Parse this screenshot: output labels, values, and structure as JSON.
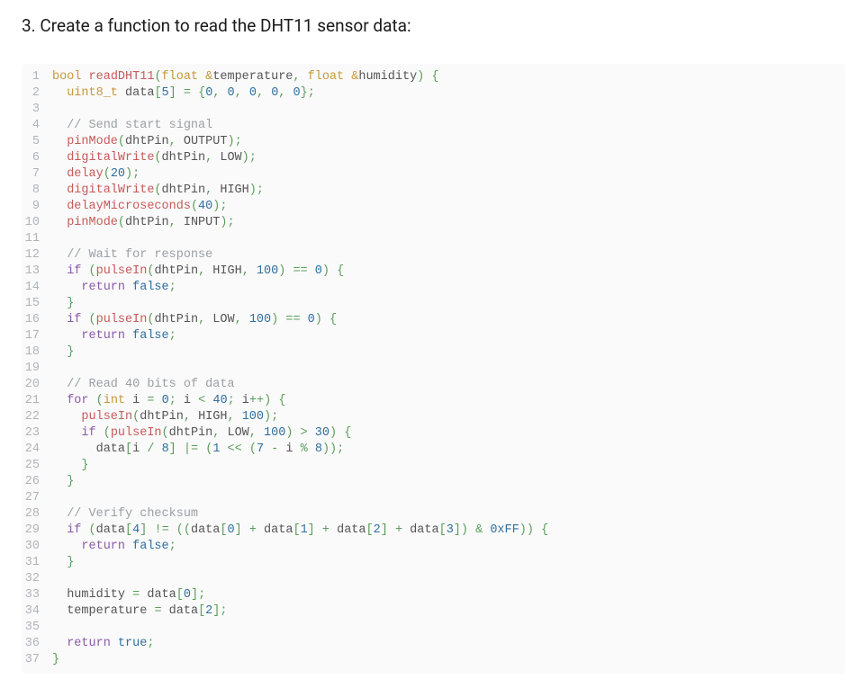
{
  "heading": "3. Create a function to read the DHT11 sensor data:",
  "code": {
    "lines": [
      [
        [
          "type",
          "bool"
        ],
        [
          "plain",
          " "
        ],
        [
          "func",
          "readDHT11"
        ],
        [
          "op",
          "("
        ],
        [
          "type",
          "float"
        ],
        [
          "plain",
          " "
        ],
        [
          "amp",
          "&"
        ],
        [
          "ident",
          "temperature"
        ],
        [
          "op",
          ","
        ],
        [
          "plain",
          " "
        ],
        [
          "type",
          "float"
        ],
        [
          "plain",
          " "
        ],
        [
          "amp",
          "&"
        ],
        [
          "ident",
          "humidity"
        ],
        [
          "op",
          ")"
        ],
        [
          "plain",
          " "
        ],
        [
          "op",
          "{"
        ]
      ],
      [
        [
          "plain",
          "  "
        ],
        [
          "type",
          "uint8_t"
        ],
        [
          "plain",
          " "
        ],
        [
          "ident",
          "data"
        ],
        [
          "op",
          "["
        ],
        [
          "num",
          "5"
        ],
        [
          "op",
          "]"
        ],
        [
          "plain",
          " "
        ],
        [
          "op",
          "="
        ],
        [
          "plain",
          " "
        ],
        [
          "op",
          "{"
        ],
        [
          "num",
          "0"
        ],
        [
          "op",
          ","
        ],
        [
          "plain",
          " "
        ],
        [
          "num",
          "0"
        ],
        [
          "op",
          ","
        ],
        [
          "plain",
          " "
        ],
        [
          "num",
          "0"
        ],
        [
          "op",
          ","
        ],
        [
          "plain",
          " "
        ],
        [
          "num",
          "0"
        ],
        [
          "op",
          ","
        ],
        [
          "plain",
          " "
        ],
        [
          "num",
          "0"
        ],
        [
          "op",
          "};"
        ]
      ],
      [],
      [
        [
          "plain",
          "  "
        ],
        [
          "comment",
          "// Send start signal"
        ]
      ],
      [
        [
          "plain",
          "  "
        ],
        [
          "func",
          "pinMode"
        ],
        [
          "op",
          "("
        ],
        [
          "ident",
          "dhtPin"
        ],
        [
          "op",
          ","
        ],
        [
          "plain",
          " "
        ],
        [
          "ident",
          "OUTPUT"
        ],
        [
          "op",
          ");"
        ]
      ],
      [
        [
          "plain",
          "  "
        ],
        [
          "func",
          "digitalWrite"
        ],
        [
          "op",
          "("
        ],
        [
          "ident",
          "dhtPin"
        ],
        [
          "op",
          ","
        ],
        [
          "plain",
          " "
        ],
        [
          "ident",
          "LOW"
        ],
        [
          "op",
          ");"
        ]
      ],
      [
        [
          "plain",
          "  "
        ],
        [
          "func",
          "delay"
        ],
        [
          "op",
          "("
        ],
        [
          "num",
          "20"
        ],
        [
          "op",
          ");"
        ]
      ],
      [
        [
          "plain",
          "  "
        ],
        [
          "func",
          "digitalWrite"
        ],
        [
          "op",
          "("
        ],
        [
          "ident",
          "dhtPin"
        ],
        [
          "op",
          ","
        ],
        [
          "plain",
          " "
        ],
        [
          "ident",
          "HIGH"
        ],
        [
          "op",
          ");"
        ]
      ],
      [
        [
          "plain",
          "  "
        ],
        [
          "func",
          "delayMicroseconds"
        ],
        [
          "op",
          "("
        ],
        [
          "num",
          "40"
        ],
        [
          "op",
          ");"
        ]
      ],
      [
        [
          "plain",
          "  "
        ],
        [
          "func",
          "pinMode"
        ],
        [
          "op",
          "("
        ],
        [
          "ident",
          "dhtPin"
        ],
        [
          "op",
          ","
        ],
        [
          "plain",
          " "
        ],
        [
          "ident",
          "INPUT"
        ],
        [
          "op",
          ");"
        ]
      ],
      [],
      [
        [
          "plain",
          "  "
        ],
        [
          "comment",
          "// Wait for response"
        ]
      ],
      [
        [
          "plain",
          "  "
        ],
        [
          "kw",
          "if"
        ],
        [
          "plain",
          " "
        ],
        [
          "op",
          "("
        ],
        [
          "func",
          "pulseIn"
        ],
        [
          "op",
          "("
        ],
        [
          "ident",
          "dhtPin"
        ],
        [
          "op",
          ","
        ],
        [
          "plain",
          " "
        ],
        [
          "ident",
          "HIGH"
        ],
        [
          "op",
          ","
        ],
        [
          "plain",
          " "
        ],
        [
          "num",
          "100"
        ],
        [
          "op",
          ")"
        ],
        [
          "plain",
          " "
        ],
        [
          "op",
          "=="
        ],
        [
          "plain",
          " "
        ],
        [
          "num",
          "0"
        ],
        [
          "op",
          ")"
        ],
        [
          "plain",
          " "
        ],
        [
          "op",
          "{"
        ]
      ],
      [
        [
          "plain",
          "    "
        ],
        [
          "kw",
          "return"
        ],
        [
          "plain",
          " "
        ],
        [
          "bool",
          "false"
        ],
        [
          "op",
          ";"
        ]
      ],
      [
        [
          "plain",
          "  "
        ],
        [
          "op",
          "}"
        ]
      ],
      [
        [
          "plain",
          "  "
        ],
        [
          "kw",
          "if"
        ],
        [
          "plain",
          " "
        ],
        [
          "op",
          "("
        ],
        [
          "func",
          "pulseIn"
        ],
        [
          "op",
          "("
        ],
        [
          "ident",
          "dhtPin"
        ],
        [
          "op",
          ","
        ],
        [
          "plain",
          " "
        ],
        [
          "ident",
          "LOW"
        ],
        [
          "op",
          ","
        ],
        [
          "plain",
          " "
        ],
        [
          "num",
          "100"
        ],
        [
          "op",
          ")"
        ],
        [
          "plain",
          " "
        ],
        [
          "op",
          "=="
        ],
        [
          "plain",
          " "
        ],
        [
          "num",
          "0"
        ],
        [
          "op",
          ")"
        ],
        [
          "plain",
          " "
        ],
        [
          "op",
          "{"
        ]
      ],
      [
        [
          "plain",
          "    "
        ],
        [
          "kw",
          "return"
        ],
        [
          "plain",
          " "
        ],
        [
          "bool",
          "false"
        ],
        [
          "op",
          ";"
        ]
      ],
      [
        [
          "plain",
          "  "
        ],
        [
          "op",
          "}"
        ]
      ],
      [],
      [
        [
          "plain",
          "  "
        ],
        [
          "comment",
          "// Read 40 bits of data"
        ]
      ],
      [
        [
          "plain",
          "  "
        ],
        [
          "kw",
          "for"
        ],
        [
          "plain",
          " "
        ],
        [
          "op",
          "("
        ],
        [
          "type",
          "int"
        ],
        [
          "plain",
          " "
        ],
        [
          "ident",
          "i"
        ],
        [
          "plain",
          " "
        ],
        [
          "op",
          "="
        ],
        [
          "plain",
          " "
        ],
        [
          "num",
          "0"
        ],
        [
          "op",
          ";"
        ],
        [
          "plain",
          " "
        ],
        [
          "ident",
          "i"
        ],
        [
          "plain",
          " "
        ],
        [
          "op",
          "<"
        ],
        [
          "plain",
          " "
        ],
        [
          "num",
          "40"
        ],
        [
          "op",
          ";"
        ],
        [
          "plain",
          " "
        ],
        [
          "ident",
          "i"
        ],
        [
          "op",
          "++)"
        ],
        [
          "plain",
          " "
        ],
        [
          "op",
          "{"
        ]
      ],
      [
        [
          "plain",
          "    "
        ],
        [
          "func",
          "pulseIn"
        ],
        [
          "op",
          "("
        ],
        [
          "ident",
          "dhtPin"
        ],
        [
          "op",
          ","
        ],
        [
          "plain",
          " "
        ],
        [
          "ident",
          "HIGH"
        ],
        [
          "op",
          ","
        ],
        [
          "plain",
          " "
        ],
        [
          "num",
          "100"
        ],
        [
          "op",
          ");"
        ]
      ],
      [
        [
          "plain",
          "    "
        ],
        [
          "kw",
          "if"
        ],
        [
          "plain",
          " "
        ],
        [
          "op",
          "("
        ],
        [
          "func",
          "pulseIn"
        ],
        [
          "op",
          "("
        ],
        [
          "ident",
          "dhtPin"
        ],
        [
          "op",
          ","
        ],
        [
          "plain",
          " "
        ],
        [
          "ident",
          "LOW"
        ],
        [
          "op",
          ","
        ],
        [
          "plain",
          " "
        ],
        [
          "num",
          "100"
        ],
        [
          "op",
          ")"
        ],
        [
          "plain",
          " "
        ],
        [
          "op",
          ">"
        ],
        [
          "plain",
          " "
        ],
        [
          "num",
          "30"
        ],
        [
          "op",
          ")"
        ],
        [
          "plain",
          " "
        ],
        [
          "op",
          "{"
        ]
      ],
      [
        [
          "plain",
          "      "
        ],
        [
          "ident",
          "data"
        ],
        [
          "op",
          "["
        ],
        [
          "ident",
          "i"
        ],
        [
          "plain",
          " "
        ],
        [
          "op",
          "/"
        ],
        [
          "plain",
          " "
        ],
        [
          "num",
          "8"
        ],
        [
          "op",
          "]"
        ],
        [
          "plain",
          " "
        ],
        [
          "op",
          "|="
        ],
        [
          "plain",
          " "
        ],
        [
          "op",
          "("
        ],
        [
          "num",
          "1"
        ],
        [
          "plain",
          " "
        ],
        [
          "op",
          "<<"
        ],
        [
          "plain",
          " "
        ],
        [
          "op",
          "("
        ],
        [
          "num",
          "7"
        ],
        [
          "plain",
          " "
        ],
        [
          "op",
          "-"
        ],
        [
          "plain",
          " "
        ],
        [
          "ident",
          "i"
        ],
        [
          "plain",
          " "
        ],
        [
          "op",
          "%"
        ],
        [
          "plain",
          " "
        ],
        [
          "num",
          "8"
        ],
        [
          "op",
          "));"
        ]
      ],
      [
        [
          "plain",
          "    "
        ],
        [
          "op",
          "}"
        ]
      ],
      [
        [
          "plain",
          "  "
        ],
        [
          "op",
          "}"
        ]
      ],
      [],
      [
        [
          "plain",
          "  "
        ],
        [
          "comment",
          "// Verify checksum"
        ]
      ],
      [
        [
          "plain",
          "  "
        ],
        [
          "kw",
          "if"
        ],
        [
          "plain",
          " "
        ],
        [
          "op",
          "("
        ],
        [
          "ident",
          "data"
        ],
        [
          "op",
          "["
        ],
        [
          "num",
          "4"
        ],
        [
          "op",
          "]"
        ],
        [
          "plain",
          " "
        ],
        [
          "op",
          "!="
        ],
        [
          "plain",
          " "
        ],
        [
          "op",
          "(("
        ],
        [
          "ident",
          "data"
        ],
        [
          "op",
          "["
        ],
        [
          "num",
          "0"
        ],
        [
          "op",
          "]"
        ],
        [
          "plain",
          " "
        ],
        [
          "op",
          "+"
        ],
        [
          "plain",
          " "
        ],
        [
          "ident",
          "data"
        ],
        [
          "op",
          "["
        ],
        [
          "num",
          "1"
        ],
        [
          "op",
          "]"
        ],
        [
          "plain",
          " "
        ],
        [
          "op",
          "+"
        ],
        [
          "plain",
          " "
        ],
        [
          "ident",
          "data"
        ],
        [
          "op",
          "["
        ],
        [
          "num",
          "2"
        ],
        [
          "op",
          "]"
        ],
        [
          "plain",
          " "
        ],
        [
          "op",
          "+"
        ],
        [
          "plain",
          " "
        ],
        [
          "ident",
          "data"
        ],
        [
          "op",
          "["
        ],
        [
          "num",
          "3"
        ],
        [
          "op",
          "])"
        ],
        [
          "plain",
          " "
        ],
        [
          "op",
          "&"
        ],
        [
          "plain",
          " "
        ],
        [
          "num",
          "0xFF"
        ],
        [
          "op",
          "))"
        ],
        [
          "plain",
          " "
        ],
        [
          "op",
          "{"
        ]
      ],
      [
        [
          "plain",
          "    "
        ],
        [
          "kw",
          "return"
        ],
        [
          "plain",
          " "
        ],
        [
          "bool",
          "false"
        ],
        [
          "op",
          ";"
        ]
      ],
      [
        [
          "plain",
          "  "
        ],
        [
          "op",
          "}"
        ]
      ],
      [],
      [
        [
          "plain",
          "  "
        ],
        [
          "ident",
          "humidity"
        ],
        [
          "plain",
          " "
        ],
        [
          "op",
          "="
        ],
        [
          "plain",
          " "
        ],
        [
          "ident",
          "data"
        ],
        [
          "op",
          "["
        ],
        [
          "num",
          "0"
        ],
        [
          "op",
          "];"
        ]
      ],
      [
        [
          "plain",
          "  "
        ],
        [
          "ident",
          "temperature"
        ],
        [
          "plain",
          " "
        ],
        [
          "op",
          "="
        ],
        [
          "plain",
          " "
        ],
        [
          "ident",
          "data"
        ],
        [
          "op",
          "["
        ],
        [
          "num",
          "2"
        ],
        [
          "op",
          "];"
        ]
      ],
      [],
      [
        [
          "plain",
          "  "
        ],
        [
          "kw",
          "return"
        ],
        [
          "plain",
          " "
        ],
        [
          "bool",
          "true"
        ],
        [
          "op",
          ";"
        ]
      ],
      [
        [
          "op",
          "}"
        ]
      ]
    ]
  }
}
